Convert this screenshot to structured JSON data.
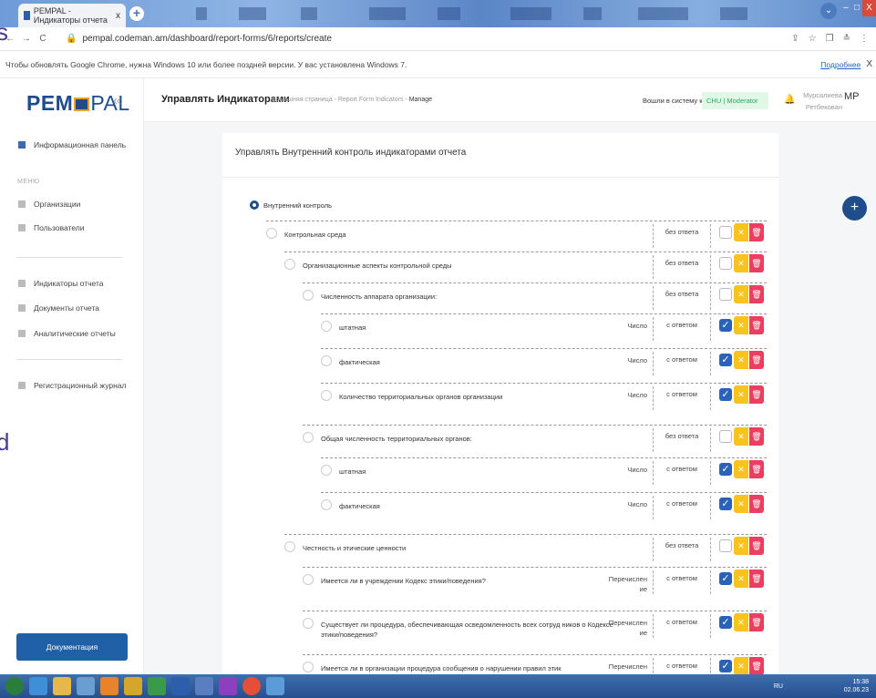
{
  "browser": {
    "tab_title": "PEMPAL - Индикаторы отчета",
    "tab_close": "x",
    "new_tab": "+",
    "url": "pempal.codeman.am/dashboard/report-forms/6/reports/create",
    "nav_back": "←",
    "nav_forward": "→",
    "reload": "C",
    "lock_icon": "lock-icon",
    "tools": [
      "⇪",
      "☆",
      "❐",
      "≛",
      "⋮"
    ],
    "window_min": "‒",
    "window_max": "□",
    "window_close": "X"
  },
  "infobar": {
    "message": "Чтобы обновлять Google Chrome, нужна Windows 10 или более поздней версии. У вас установлена Windows 7.",
    "more_link": "Подробнее",
    "close": "X"
  },
  "sidebar": {
    "logo_left": "PEM",
    "logo_right": "PAL",
    "collapse": "«",
    "dashboard_label": "Информационная панель",
    "menu_header": "МЕНЮ",
    "items": [
      {
        "label": "Организации",
        "icon": "building-icon"
      },
      {
        "label": "Пользователи",
        "icon": "users-icon"
      },
      {
        "label": "Индикаторы отчета",
        "icon": "document-icon"
      },
      {
        "label": "Документы отчета",
        "icon": "document-icon"
      },
      {
        "label": "Аналитические отчеты",
        "icon": "chart-icon"
      },
      {
        "label": "Регистрационный журнал",
        "icon": "log-icon"
      }
    ],
    "doc_button": "Документация"
  },
  "header": {
    "title": "Управлять Индикаторами",
    "breadcrumb_home": "Домашняя страница",
    "breadcrumb_mid": "Report Form Indicators",
    "breadcrumb_current": "Manage",
    "breadcrumb_sep": "-",
    "logged_as": "Вошли в систему как",
    "role": "CHU | Moderator",
    "user_name_1": "Мурсалиева",
    "user_name_2": "Ретбекован",
    "initials": "MP"
  },
  "card": {
    "title": "Управлять Внутренний контроль индикаторами отчета",
    "root_label": "Внутренний контроль"
  },
  "rows": [
    {
      "label": "Контрольная среда",
      "type": "",
      "answer": "без ответа",
      "checked": false
    },
    {
      "label": "Организационные аспекты контрольной среды",
      "type": "",
      "answer": "без ответа",
      "checked": false
    },
    {
      "label": "Численность аппарата организации:",
      "type": "",
      "answer": "без ответа",
      "checked": false
    },
    {
      "label": "штатная",
      "type": "Число",
      "answer": "с ответом",
      "checked": true
    },
    {
      "label": "фактическая",
      "type": "Число",
      "answer": "с ответом",
      "checked": true
    },
    {
      "label": "Количество территориальных органов организации",
      "type": "Число",
      "answer": "с ответом",
      "checked": true
    },
    {
      "label": "Общая численность территориальных органов:",
      "type": "",
      "answer": "без ответа",
      "checked": false
    },
    {
      "label": "штатная",
      "type": "Число",
      "answer": "с ответом",
      "checked": true
    },
    {
      "label": "фактическая",
      "type": "Число",
      "answer": "с ответом",
      "checked": true
    },
    {
      "label": "Честность и этические ценности",
      "type": "",
      "answer": "без ответа",
      "checked": false
    },
    {
      "label": "Имеется ли в учреждении Кодекс этики/поведения?",
      "type": "Перечислен ие",
      "answer": "с ответом",
      "checked": true
    },
    {
      "label": "Существует ли процедура, обеспечивающая осведомленность всех сотруд ников о Кодексе этики/поведения?",
      "type": "Перечислен ие",
      "answer": "с ответом",
      "checked": true
    },
    {
      "label": "Имеется ли в организации процедура сообщения о нарушении правил этик",
      "type": "Перечислен",
      "answer": "с ответом",
      "checked": true
    }
  ],
  "actions": {
    "edit_symbol": "✕",
    "delete_symbol": "🗑",
    "check_symbol": "✓",
    "add_symbol": "+"
  },
  "taskbar": {
    "lang": "RU",
    "time": "15:38",
    "date": "02.06.23"
  },
  "frame_text": {
    "left_1": "s",
    "left_2": "d"
  }
}
